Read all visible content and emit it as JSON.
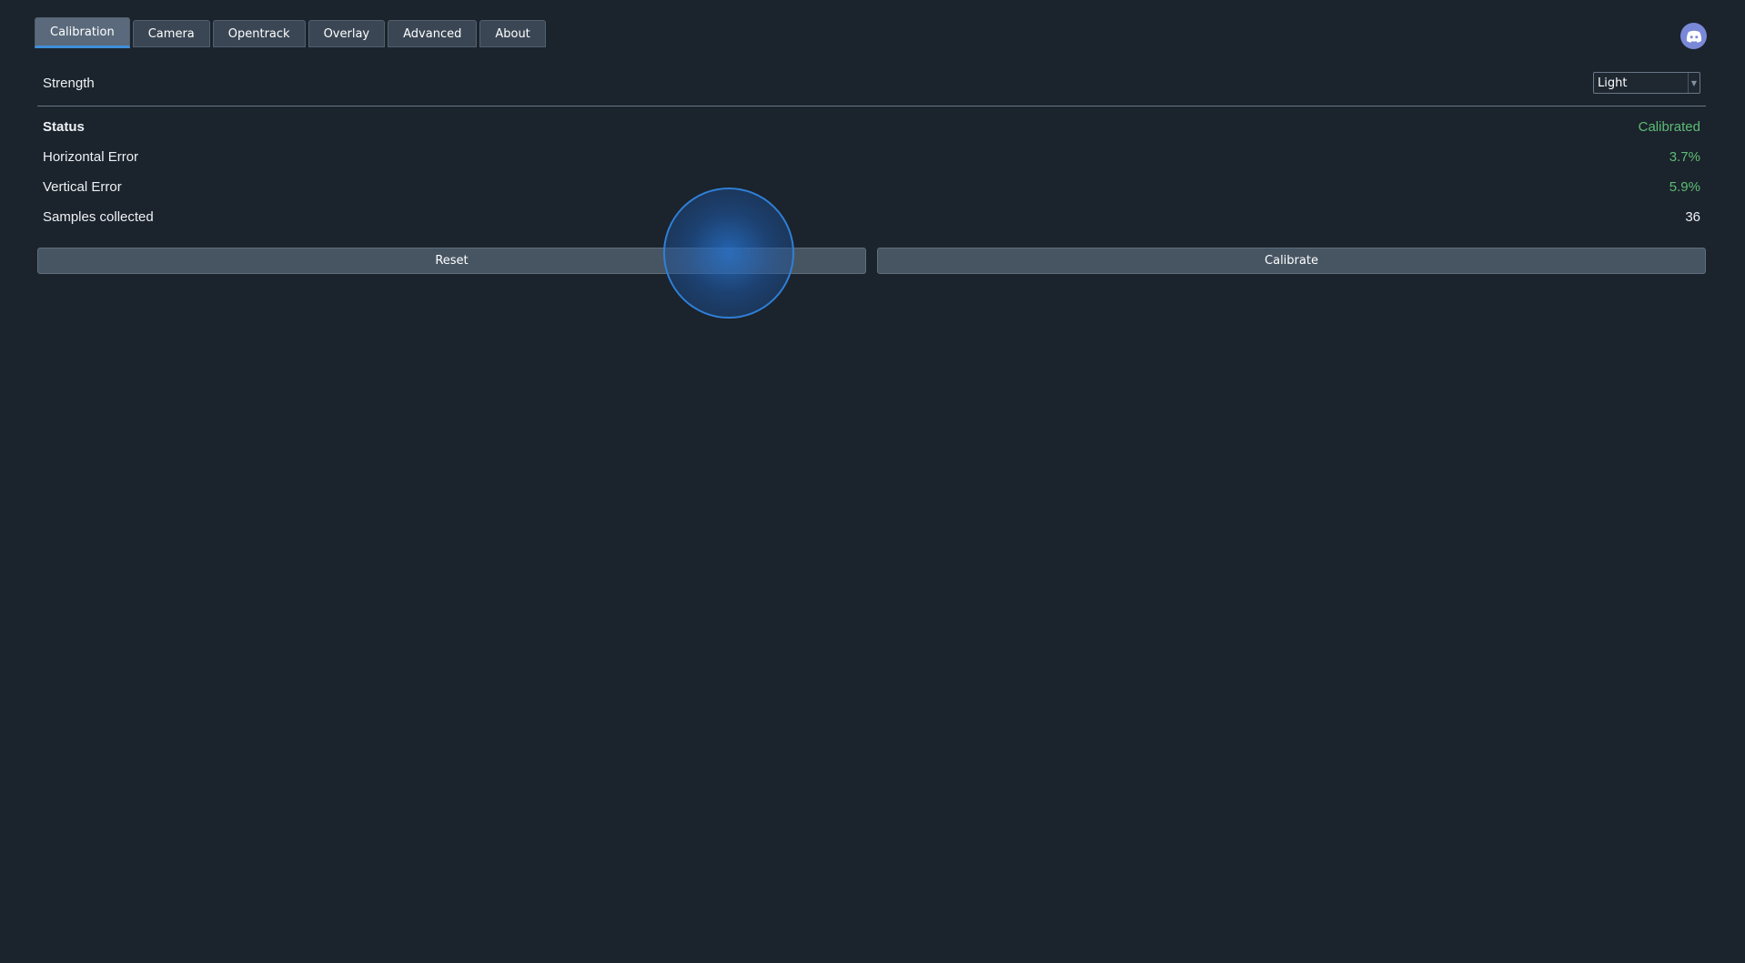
{
  "tabs": [
    {
      "label": "Calibration",
      "active": true
    },
    {
      "label": "Camera",
      "active": false
    },
    {
      "label": "Opentrack",
      "active": false
    },
    {
      "label": "Overlay",
      "active": false
    },
    {
      "label": "Advanced",
      "active": false
    },
    {
      "label": "About",
      "active": false
    }
  ],
  "header": {
    "discord_icon": "discord-icon"
  },
  "strength": {
    "label": "Strength",
    "selected": "Light"
  },
  "status": {
    "label": "Status",
    "value": "Calibrated"
  },
  "horizontal_error": {
    "label": "Horizontal Error",
    "value": "3.7%"
  },
  "vertical_error": {
    "label": "Vertical Error",
    "value": "5.9%"
  },
  "samples": {
    "label": "Samples collected",
    "value": "36"
  },
  "buttons": {
    "reset_label": "Reset",
    "calibrate_label": "Calibrate"
  },
  "colors": {
    "background": "#1b232c",
    "accent": "#3e8ed8",
    "success": "#5dbd76",
    "discord": "#7a88d8"
  }
}
